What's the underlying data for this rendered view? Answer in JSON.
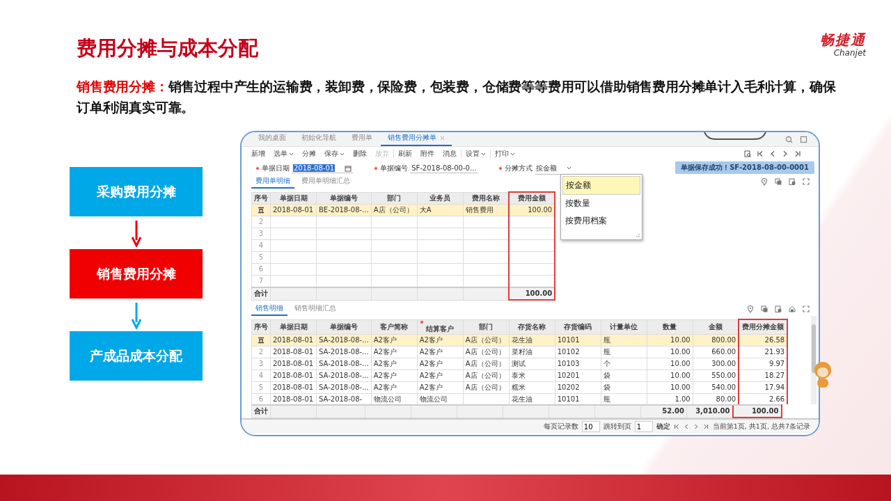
{
  "slide": {
    "title": "费用分摊与成本分配",
    "logo": {
      "name": "畅捷通",
      "latin": "Chanjet"
    },
    "intro": "**销售费用分摊：**销售过程中产生的运输费，装卸费，保险费，包装费，仓储费等等费用可以借助销售费用分摊单计入毛利计算，确保订单利润真实可靠。"
  },
  "flow": [
    {
      "label": "采购费用分摊",
      "color": "#00a8e8"
    },
    {
      "label": "销售费用分摊",
      "color": "#f00000"
    },
    {
      "label": "产成品成本分配",
      "color": "#00a8e8"
    }
  ],
  "app": {
    "tabs": [
      {
        "label": "我的桌面",
        "selected": false
      },
      {
        "label": "初始化导航",
        "selected": false
      },
      {
        "label": "费用单",
        "selected": false
      },
      {
        "label": "销售费用分摊单",
        "selected": true,
        "closable": true
      }
    ],
    "toolbar": [
      [
        {
          "label": "新增",
          "disabled": false
        },
        {
          "label": "选单",
          "disabled": false,
          "menu": true
        },
        {
          "label": "分摊",
          "disabled": false
        },
        {
          "label": "保存",
          "disabled": false,
          "menu": true
        },
        {
          "label": "删除",
          "disabled": false
        },
        {
          "label": "放弃",
          "disabled": true
        }
      ],
      [
        {
          "label": "刷新",
          "disabled": false
        },
        {
          "label": "附件",
          "disabled": false
        },
        {
          "label": "消息",
          "disabled": false
        }
      ],
      [
        {
          "label": "设置",
          "disabled": false,
          "menu": true
        }
      ],
      [
        {
          "label": "打印",
          "disabled": false,
          "menu": true
        }
      ]
    ],
    "fields": [
      {
        "kind": "date",
        "label": "单据日期",
        "value": "2018-08-01",
        "required": true,
        "highlighted": true
      },
      {
        "kind": "text",
        "label": "单据编号",
        "value": "SF-2018-08-00-0...",
        "required": true,
        "highlighted": false
      },
      {
        "kind": "select",
        "label": "分摊方式",
        "value": "按金额",
        "required": true,
        "highlighted": false
      }
    ],
    "notice": "单据保存成功！SF-2018-08-00-0001",
    "upper": {
      "tabs": [
        {
          "label": "费用单明细",
          "selected": true
        },
        {
          "label": "费用单明细汇总",
          "selected": false
        }
      ],
      "columns": [
        {
          "label": "序号",
          "kind": "index"
        },
        {
          "label": "单据日期",
          "kind": "text"
        },
        {
          "label": "单据编号",
          "kind": "text"
        },
        {
          "label": "部门",
          "kind": "text"
        },
        {
          "label": "业务员",
          "kind": "text"
        },
        {
          "label": "费用名称",
          "kind": "text"
        },
        {
          "label": "费用金额",
          "kind": "number",
          "highlighted": true,
          "total": "100.00"
        }
      ],
      "rows": [
        {
          "selected": true,
          "cells": [
            "",
            "2018-08-01",
            "BE-2018-08-...",
            "A店（公司）",
            "大A",
            "销售费用",
            "100.00"
          ]
        },
        {
          "selected": false,
          "cells": [
            "2"
          ]
        },
        {
          "selected": false,
          "cells": [
            "3"
          ]
        },
        {
          "selected": false,
          "cells": [
            "4"
          ]
        },
        {
          "selected": false,
          "cells": [
            "5"
          ]
        },
        {
          "selected": false,
          "cells": [
            "6"
          ]
        },
        {
          "selected": false,
          "cells": [
            "7"
          ]
        }
      ],
      "total_label": "合计"
    },
    "popup": [
      {
        "label": "按金额",
        "selected": true
      },
      {
        "label": "按数量",
        "selected": false
      },
      {
        "label": "按费用档案",
        "selected": false
      }
    ],
    "lower": {
      "tabs": [
        {
          "label": "销售明细",
          "selected": true
        },
        {
          "label": "销售明细汇总",
          "selected": false
        }
      ],
      "columns": [
        {
          "label": "序号",
          "kind": "index"
        },
        {
          "label": "单据日期",
          "kind": "text"
        },
        {
          "label": "单据编号",
          "kind": "text"
        },
        {
          "label": "客户简称",
          "kind": "text"
        },
        {
          "label": "结算客户",
          "kind": "text",
          "required": true
        },
        {
          "label": "部门",
          "kind": "text"
        },
        {
          "label": "存货名称",
          "kind": "text"
        },
        {
          "label": "存货编码",
          "kind": "text"
        },
        {
          "label": "计量单位",
          "kind": "text"
        },
        {
          "label": "数量",
          "kind": "number",
          "total": "52.00"
        },
        {
          "label": "金额",
          "kind": "number",
          "total": "3,010.00"
        },
        {
          "label": "费用分摊金额",
          "kind": "number",
          "highlighted": true,
          "total": "100.00"
        }
      ],
      "rows": [
        {
          "selected": true,
          "cells": [
            "",
            "2018-08-01",
            "SA-2018-08-...",
            "A2客户",
            "A2客户",
            "A店（公司）",
            "花生油",
            "10101",
            "瓶",
            "10.00",
            "800.00",
            "26.58"
          ]
        },
        {
          "selected": false,
          "cells": [
            "2",
            "2018-08-01",
            "SA-2018-08-...",
            "A2客户",
            "A2客户",
            "A店（公司）",
            "菜籽油",
            "10102",
            "瓶",
            "10.00",
            "660.00",
            "21.93"
          ]
        },
        {
          "selected": false,
          "cells": [
            "3",
            "2018-08-01",
            "SA-2018-08-...",
            "A2客户",
            "A2客户",
            "A店（公司）",
            "测试",
            "10103",
            "个",
            "10.00",
            "300.00",
            "9.97"
          ]
        },
        {
          "selected": false,
          "cells": [
            "4",
            "2018-08-01",
            "SA-2018-08-...",
            "A2客户",
            "A2客户",
            "A店（公司）",
            "泰米",
            "10201",
            "袋",
            "10.00",
            "550.00",
            "18.27"
          ]
        },
        {
          "selected": false,
          "cells": [
            "5",
            "2018-08-01",
            "SA-2018-08-...",
            "A2客户",
            "A2客户",
            "A店（公司）",
            "糯米",
            "10202",
            "袋",
            "10.00",
            "540.00",
            "17.94"
          ]
        },
        {
          "selected": false,
          "cells": [
            "6",
            "2018-08-01",
            "SA-2018-08-",
            "物流公司",
            "物流公司",
            null,
            "花生油",
            "10101",
            "瓶",
            "1.00",
            "80.00",
            "2.66"
          ]
        }
      ],
      "total_label": "合计"
    },
    "pager": {
      "page_size_label": "每页记录数",
      "page_size": "10",
      "jump_label": "跳转到页",
      "jump": "1",
      "confirm": "确定",
      "status": "当前第1页, 共1页, 总共7条记录"
    }
  }
}
